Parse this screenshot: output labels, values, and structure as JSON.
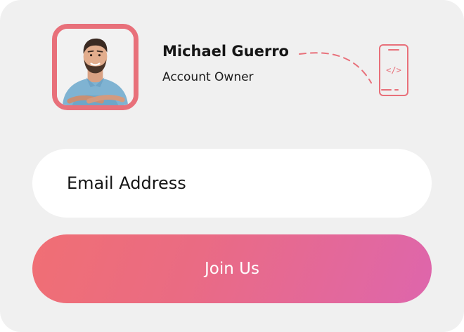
{
  "profile": {
    "name": "Michael Guerro",
    "role": "Account Owner",
    "avatar_alt": "Michael Guerro"
  },
  "device": {
    "icon": "mobile-code-icon",
    "code_glyph": "</>"
  },
  "form": {
    "email_placeholder": "Email Address",
    "email_value": "",
    "submit_label": "Join Us"
  },
  "colors": {
    "card_background": "#f0f0f0",
    "accent": "#e8707a",
    "button_gradient_start": "#f06f74",
    "button_gradient_end": "#de66ac",
    "text": "#151515"
  }
}
